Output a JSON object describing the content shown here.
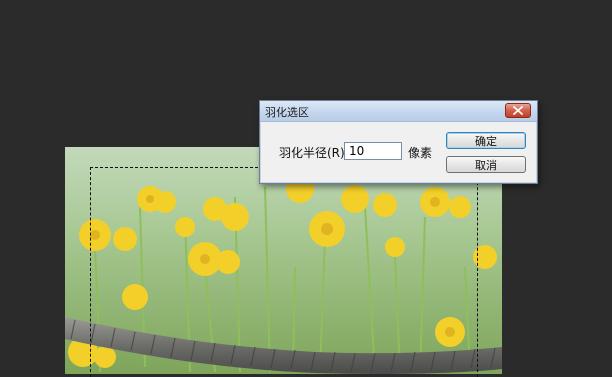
{
  "dialog": {
    "title": "羽化选区",
    "radius_label": "羽化半径(R):",
    "radius_value": "10",
    "unit": "像素",
    "ok_label": "确定",
    "cancel_label": "取消"
  },
  "icons": {
    "close": "close-x-icon"
  },
  "colors": {
    "workspace_bg": "#2b2b2b",
    "dialog_bg": "#f0f0f0",
    "close_red": "#c8452f",
    "ok_border": "#3c7fb1"
  }
}
